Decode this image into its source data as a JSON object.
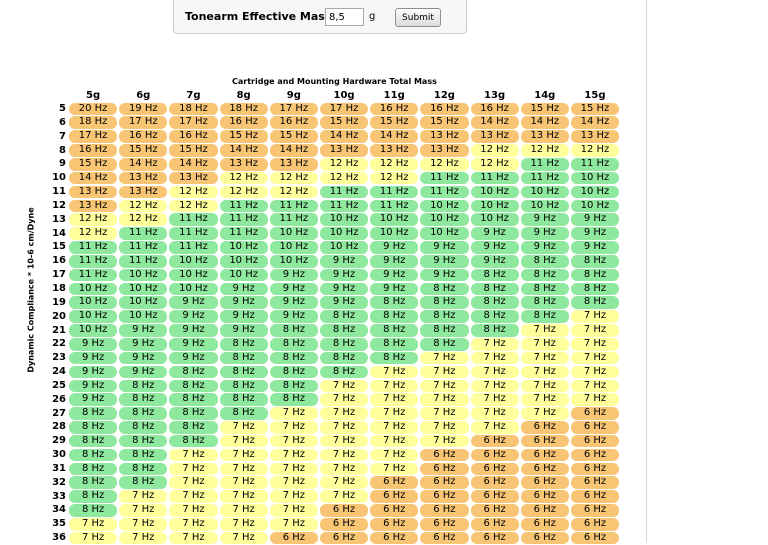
{
  "form": {
    "label": "Tonearm Effective Mass",
    "mass_value": "8,5",
    "unit": "g",
    "submit_label": "Submit"
  },
  "table": {
    "title": "Cartridge and Mounting Hardware Total Mass",
    "y_axis_label": "Dynamic Compliance * 10-6 cm/Dyne",
    "columns": [
      "5g",
      "6g",
      "7g",
      "8g",
      "9g",
      "10g",
      "11g",
      "12g",
      "13g",
      "14g",
      "15g"
    ],
    "unit_suffix": " Hz",
    "colors": {
      "orange": "#f8c574",
      "yellow": "#ffff9c",
      "green": "#8ee89e"
    },
    "legend_rule": "green = 8–11 Hz, yellow = 12 Hz and 7 Hz, orange = 13 Hz and above or 6 Hz and below",
    "rows": [
      {
        "c": "5",
        "v": [
          20,
          19,
          18,
          18,
          17,
          17,
          16,
          16,
          16,
          15,
          15
        ]
      },
      {
        "c": "6",
        "v": [
          18,
          17,
          17,
          16,
          16,
          15,
          15,
          15,
          14,
          14,
          14
        ]
      },
      {
        "c": "7",
        "v": [
          17,
          16,
          16,
          15,
          15,
          14,
          14,
          13,
          13,
          13,
          13
        ]
      },
      {
        "c": "8",
        "v": [
          16,
          15,
          15,
          14,
          14,
          13,
          13,
          13,
          12,
          12,
          12
        ]
      },
      {
        "c": "9",
        "v": [
          15,
          14,
          14,
          13,
          13,
          12,
          12,
          12,
          12,
          11,
          11
        ]
      },
      {
        "c": "10",
        "v": [
          14,
          13,
          13,
          12,
          12,
          12,
          12,
          11,
          11,
          11,
          10
        ]
      },
      {
        "c": "11",
        "v": [
          13,
          13,
          12,
          12,
          12,
          11,
          11,
          11,
          10,
          10,
          10
        ]
      },
      {
        "c": "12",
        "v": [
          13,
          12,
          12,
          11,
          11,
          11,
          11,
          10,
          10,
          10,
          10
        ]
      },
      {
        "c": "13",
        "v": [
          12,
          12,
          11,
          11,
          11,
          10,
          10,
          10,
          10,
          9,
          9
        ]
      },
      {
        "c": "14",
        "v": [
          12,
          11,
          11,
          11,
          10,
          10,
          10,
          10,
          9,
          9,
          9
        ]
      },
      {
        "c": "15",
        "v": [
          11,
          11,
          11,
          10,
          10,
          10,
          9,
          9,
          9,
          9,
          9
        ]
      },
      {
        "c": "16",
        "v": [
          11,
          11,
          10,
          10,
          10,
          9,
          9,
          9,
          9,
          8,
          8
        ]
      },
      {
        "c": "17",
        "v": [
          11,
          10,
          10,
          10,
          9,
          9,
          9,
          9,
          8,
          8,
          8
        ]
      },
      {
        "c": "18",
        "v": [
          10,
          10,
          10,
          9,
          9,
          9,
          9,
          8,
          8,
          8,
          8
        ]
      },
      {
        "c": "19",
        "v": [
          10,
          10,
          9,
          9,
          9,
          9,
          8,
          8,
          8,
          8,
          8
        ]
      },
      {
        "c": "20",
        "v": [
          10,
          10,
          9,
          9,
          9,
          8,
          8,
          8,
          8,
          8,
          7
        ]
      },
      {
        "c": "21",
        "v": [
          10,
          9,
          9,
          9,
          8,
          8,
          8,
          8,
          8,
          7,
          7
        ]
      },
      {
        "c": "22",
        "v": [
          9,
          9,
          9,
          8,
          8,
          8,
          8,
          8,
          7,
          7,
          7
        ]
      },
      {
        "c": "23",
        "v": [
          9,
          9,
          9,
          8,
          8,
          8,
          8,
          7,
          7,
          7,
          7
        ]
      },
      {
        "c": "24",
        "v": [
          9,
          9,
          8,
          8,
          8,
          8,
          7,
          7,
          7,
          7,
          7
        ]
      },
      {
        "c": "25",
        "v": [
          9,
          8,
          8,
          8,
          8,
          7,
          7,
          7,
          7,
          7,
          7
        ]
      },
      {
        "c": "26",
        "v": [
          9,
          8,
          8,
          8,
          8,
          7,
          7,
          7,
          7,
          7,
          7
        ]
      },
      {
        "c": "27",
        "v": [
          8,
          8,
          8,
          8,
          7,
          7,
          7,
          7,
          7,
          7,
          6
        ]
      },
      {
        "c": "28",
        "v": [
          8,
          8,
          8,
          7,
          7,
          7,
          7,
          7,
          7,
          6,
          6
        ]
      },
      {
        "c": "29",
        "v": [
          8,
          8,
          8,
          7,
          7,
          7,
          7,
          7,
          6,
          6,
          6
        ]
      },
      {
        "c": "30",
        "v": [
          8,
          8,
          7,
          7,
          7,
          7,
          7,
          6,
          6,
          6,
          6
        ]
      },
      {
        "c": "31",
        "v": [
          8,
          8,
          7,
          7,
          7,
          7,
          7,
          6,
          6,
          6,
          6
        ]
      },
      {
        "c": "32",
        "v": [
          8,
          8,
          7,
          7,
          7,
          7,
          6,
          6,
          6,
          6,
          6
        ]
      },
      {
        "c": "33",
        "v": [
          8,
          7,
          7,
          7,
          7,
          7,
          6,
          6,
          6,
          6,
          6
        ]
      },
      {
        "c": "34",
        "v": [
          8,
          7,
          7,
          7,
          7,
          6,
          6,
          6,
          6,
          6,
          6
        ]
      },
      {
        "c": "35",
        "v": [
          7,
          7,
          7,
          7,
          7,
          6,
          6,
          6,
          6,
          6,
          6
        ]
      },
      {
        "c": "36",
        "v": [
          7,
          7,
          7,
          7,
          6,
          6,
          6,
          6,
          6,
          6,
          6
        ]
      }
    ]
  }
}
